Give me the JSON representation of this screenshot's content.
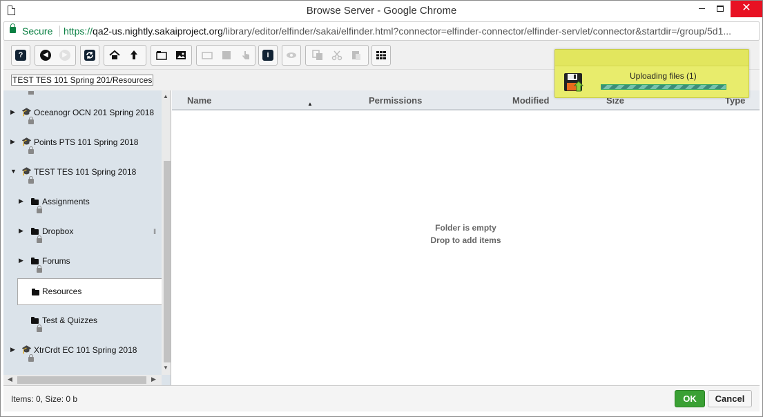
{
  "window": {
    "title": "Browse Server - Google Chrome",
    "close_glyph": "✕"
  },
  "address": {
    "secure_label": "Secure",
    "protocol": "https://",
    "host": "qa2-us.nightly.sakaiproject.org",
    "path": "/library/editor/elfinder/sakai/elfinder.html?connector=elfinder-connector/elfinder-servlet/connector&startdir=/group/5d1..."
  },
  "toolbar": {
    "help_glyph": "?",
    "info_glyph": "i"
  },
  "path_bar": {
    "path": "TEST TES 101 Spring 201/Resources"
  },
  "tree": {
    "items": [
      {
        "label": "Oceanogr OCN 201 Spring 2018",
        "arrow": "▶",
        "icon": "graduation-cap-icon"
      },
      {
        "label": "Points PTS 101 Spring 2018",
        "arrow": "▶",
        "icon": "graduation-cap-icon"
      },
      {
        "label": "TEST TES 101 Spring 2018",
        "arrow": "▼",
        "icon": "graduation-cap-icon"
      },
      {
        "label": "Assignments",
        "arrow": "▶",
        "icon": "folder-icon"
      },
      {
        "label": "Dropbox",
        "arrow": "▶",
        "icon": "folder-icon"
      },
      {
        "label": "Forums",
        "arrow": "▶",
        "icon": "folder-icon"
      },
      {
        "label": "Resources",
        "arrow": "",
        "icon": "folder-icon"
      },
      {
        "label": "Test & Quizzes",
        "arrow": "",
        "icon": "folder-icon"
      },
      {
        "label": "XtrCrdt EC 101 Spring 2018",
        "arrow": "▶",
        "icon": "graduation-cap-icon"
      }
    ],
    "selected": "Resources"
  },
  "columns": {
    "name": "Name",
    "permissions": "Permissions",
    "modified": "Modified",
    "size": "Size",
    "type": "Type"
  },
  "file_area": {
    "empty_line1": "Folder is empty",
    "empty_line2": "Drop to add items"
  },
  "status": {
    "text": "Items: 0, Size: 0 b",
    "ok_label": "OK",
    "cancel_label": "Cancel"
  },
  "notification": {
    "text": "Uploading files (1)",
    "progress_indeterminate": true
  },
  "colors": {
    "accent_ok": "#3aa034",
    "notification_bg": "#e8ec6c",
    "tree_bg": "#dbe3ea",
    "secure_green": "#0b8043",
    "close_red": "#e81123"
  }
}
